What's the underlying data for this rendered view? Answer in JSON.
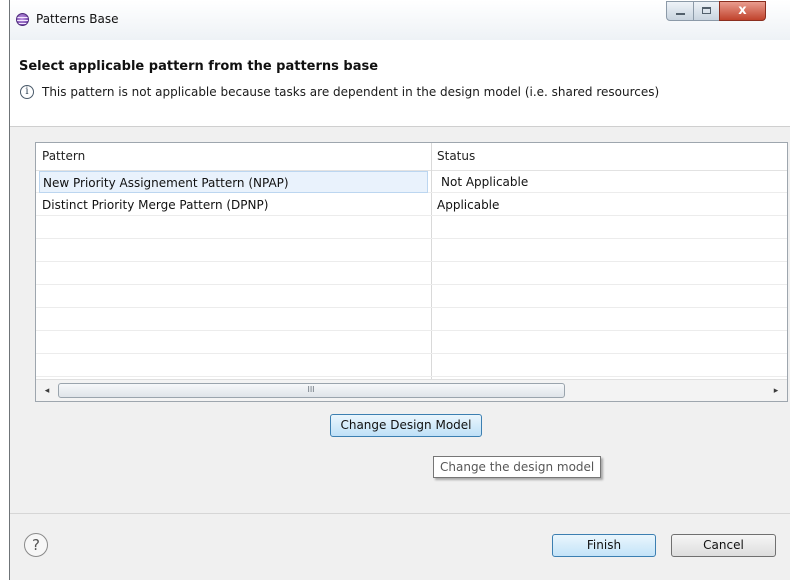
{
  "window": {
    "title": "Patterns Base",
    "icon": "eclipse-app-icon",
    "controls": {
      "minimize": "minimize-icon",
      "maximize": "maximize-icon",
      "close_glyph": "x"
    }
  },
  "header": {
    "title": "Select applicable pattern from the patterns base",
    "info_icon_glyph": "i",
    "info_message": "This pattern is not applicable because tasks are dependent in the design model (i.e. shared resources)"
  },
  "table": {
    "columns": [
      "Pattern",
      "Status"
    ],
    "rows": [
      {
        "pattern": "New Priority Assignement Pattern (NPAP)",
        "status": "Not Applicable",
        "selected": true
      },
      {
        "pattern": "Distinct Priority Merge Pattern (DPNP)",
        "status": "Applicable",
        "selected": false
      }
    ],
    "scrollbar": {
      "left_glyph": "◂",
      "right_glyph": "▸",
      "grip": "III"
    }
  },
  "actions": {
    "change_model_label": "Change Design Model",
    "tooltip": "Change the design model"
  },
  "footer": {
    "help_glyph": "?",
    "finish_label": "Finish",
    "cancel_label": "Cancel"
  },
  "colors": {
    "selection_bg": "#e9f2fc",
    "focus_border": "#3c7fb1",
    "close_button": "#c0432c",
    "dialog_bg": "#f0f0f0"
  }
}
